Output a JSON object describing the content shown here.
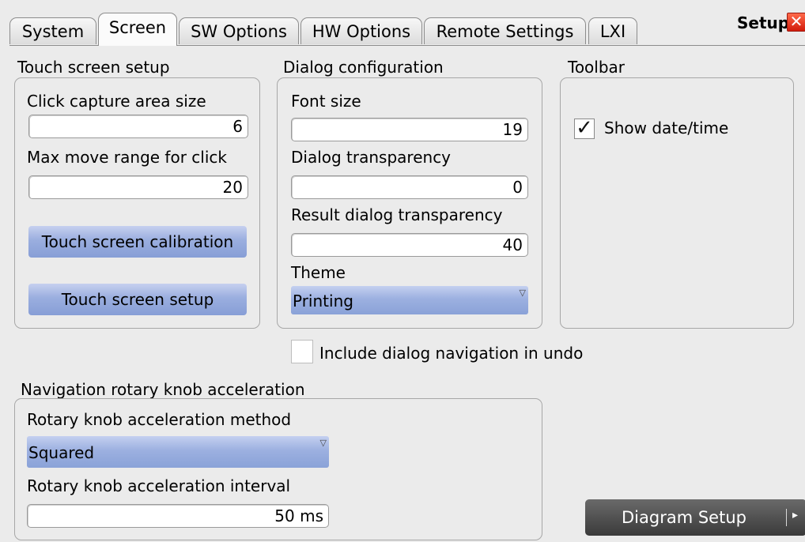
{
  "tabs": [
    "System",
    "Screen",
    "SW Options",
    "HW Options",
    "Remote Settings",
    "LXI"
  ],
  "dialog_title": "Setup",
  "touch": {
    "heading": "Touch screen setup",
    "capture_label": "Click capture area size",
    "capture_value": "6",
    "move_label": "Max move range for click",
    "move_value": "20",
    "calibration_button": "Touch screen calibration",
    "setup_button": "Touch screen setup"
  },
  "dialog": {
    "heading": "Dialog configuration",
    "font_label": "Font size",
    "font_value": "19",
    "transparency_label": "Dialog transparency",
    "transparency_value": "0",
    "result_label": "Result dialog transparency",
    "result_value": "40",
    "theme_label": "Theme",
    "theme_value": "Printing"
  },
  "toolbar": {
    "heading": "Toolbar",
    "show_datetime_label": "Show date/time",
    "show_datetime_checked": true
  },
  "undo": {
    "label": "Include dialog navigation in undo",
    "checked": false
  },
  "rotary": {
    "heading": "Navigation rotary knob acceleration",
    "method_label": "Rotary knob acceleration method",
    "method_value": "Squared",
    "interval_label": "Rotary knob acceleration interval",
    "interval_value": "50 ms"
  },
  "footer": {
    "diagram_button": "Diagram Setup"
  },
  "colors": {
    "background": "#ebebeb",
    "accent_blue": "#9aaedf",
    "close_red": "#e0301a",
    "dark_button": "#4a4a4a"
  }
}
